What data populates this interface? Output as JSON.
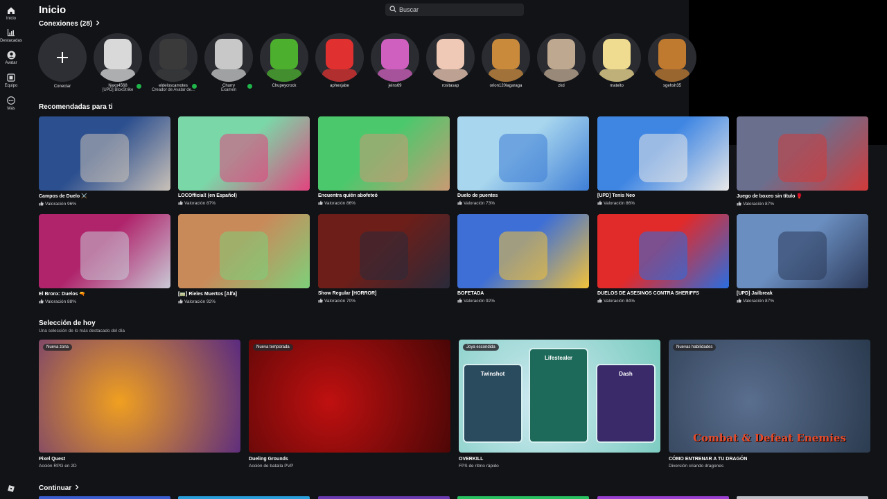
{
  "nav": [
    {
      "label": "Inicio",
      "icon": "home-icon"
    },
    {
      "label": "Destacadas",
      "icon": "chart-icon"
    },
    {
      "label": "Avatar",
      "icon": "avatar-icon"
    },
    {
      "label": "Equipo",
      "icon": "group-icon"
    },
    {
      "label": "Más",
      "icon": "more-icon"
    }
  ],
  "header": {
    "title": "Inicio",
    "search_placeholder": "Buscar"
  },
  "connections": {
    "title": "Conexiones (28)",
    "add_label": "Conectar",
    "friends": [
      {
        "name": "Naxo4568",
        "sub": "[UPD] BloxStrike",
        "online": true,
        "color": "#d9d9d9"
      },
      {
        "name": "eldeloscamotes",
        "sub": "Creador de Avatar de...",
        "online": true,
        "color": "#3a3a3a"
      },
      {
        "name": "Churry",
        "sub": "Examen",
        "online": true,
        "color": "#c8c8c8"
      },
      {
        "name": "Chupeycrock",
        "sub": "",
        "online": false,
        "color": "#4caf2d"
      },
      {
        "name": "aphexjabe",
        "sub": "",
        "online": false,
        "color": "#e03030"
      },
      {
        "name": "jeins69",
        "sub": "",
        "online": false,
        "color": "#d060c0"
      },
      {
        "name": "rositasap",
        "sub": "",
        "online": false,
        "color": "#efc9b5"
      },
      {
        "name": "orion120lagaraga",
        "sub": "",
        "online": false,
        "color": "#c98a3c"
      },
      {
        "name": "zkd",
        "sub": "",
        "online": false,
        "color": "#bfa890"
      },
      {
        "name": "mateito",
        "sub": "",
        "online": false,
        "color": "#f0dc90"
      },
      {
        "name": "sgehsh35",
        "sub": "",
        "online": false,
        "color": "#c07a30"
      }
    ]
  },
  "recommended": {
    "title": "Recomendadas para ti",
    "games": [
      {
        "name": "Campos de Duelo ⚔️",
        "rating": "Valoración 96%",
        "c1": "#2c4f8f",
        "c2": "#c9c1b8"
      },
      {
        "name": "LOCOfficial! (en Español)",
        "rating": "Valoración 87%",
        "c1": "#7ad8a8",
        "c2": "#e2447e"
      },
      {
        "name": "Encuentra quién abofeteó",
        "rating": "Valoración 86%",
        "c1": "#4cc86c",
        "c2": "#c99a74"
      },
      {
        "name": "Duelo de puentes",
        "rating": "Valoración 73%",
        "c1": "#a8d6ee",
        "c2": "#3e7ed6"
      },
      {
        "name": "[UPD] Tenis Neo",
        "rating": "Valoración 86%",
        "c1": "#3f86e3",
        "c2": "#e8e8e8"
      },
      {
        "name": "Juego de boxeo sin título 🥊",
        "rating": "Valoración 87%",
        "c1": "#6b6f8e",
        "c2": "#d23a3a"
      },
      {
        "name": "El Bronx: Duelos 🔫",
        "rating": "Valoración 88%",
        "c1": "#b0246c",
        "c2": "#c9c9d6"
      },
      {
        "name": "[🚃] Rieles Muertos [Alfa]",
        "rating": "Valoración 92%",
        "c1": "#c98a5a",
        "c2": "#7ed07a"
      },
      {
        "name": "Show Regular [HORROR]",
        "rating": "Valoración 70%",
        "c1": "#6e1e18",
        "c2": "#2a2a3a"
      },
      {
        "name": "BOFETADA",
        "rating": "Valoración 92%",
        "c1": "#3e6fd6",
        "c2": "#f2c23a"
      },
      {
        "name": "DUELOS DE ASESINOS CONTRA SHERIFFS",
        "rating": "Valoración 84%",
        "c1": "#e12a2a",
        "c2": "#2a6ee0"
      },
      {
        "name": "[UPD] Jailbreak",
        "rating": "Valoración 87%",
        "c1": "#6a8ec0",
        "c2": "#2c3a5a"
      }
    ]
  },
  "featured": {
    "title": "Selección de hoy",
    "subtitle": "Una selección de lo más destacado del día",
    "items": [
      {
        "badge": "Nueva zona",
        "name": "Pixel Quest",
        "desc": "Acción RPG en 2D",
        "c1": "#f0a020",
        "c2": "#5a2a80"
      },
      {
        "badge": "Nueva temporada",
        "name": "Dueling Grounds",
        "desc": "Acción de batalla PVP",
        "c1": "#c01010",
        "c2": "#4a0606"
      },
      {
        "badge": "Joya escondida",
        "name": "OVERKILL",
        "desc": "FPS de ritmo rápido",
        "c1": "#cfeaf2",
        "c2": "#7acbc0"
      },
      {
        "badge": "Nuevas habilidades",
        "name": "CÓMO ENTRENAR A TU DRAGÓN",
        "desc": "Diversión criando dragones",
        "c1": "#5a6e8e",
        "c2": "#2a3a4e",
        "art_text": "Combat & Defeat Enemies"
      }
    ],
    "card_labels": {
      "twinshot": "Twinshot",
      "lifestealer": "Lifestealer",
      "dash": "Dash"
    }
  },
  "continue": {
    "title": "Continuar"
  },
  "colors": {
    "background": "#121316",
    "online": "#1fb54a",
    "text": "#ffffff",
    "muted": "#c9cacd"
  }
}
